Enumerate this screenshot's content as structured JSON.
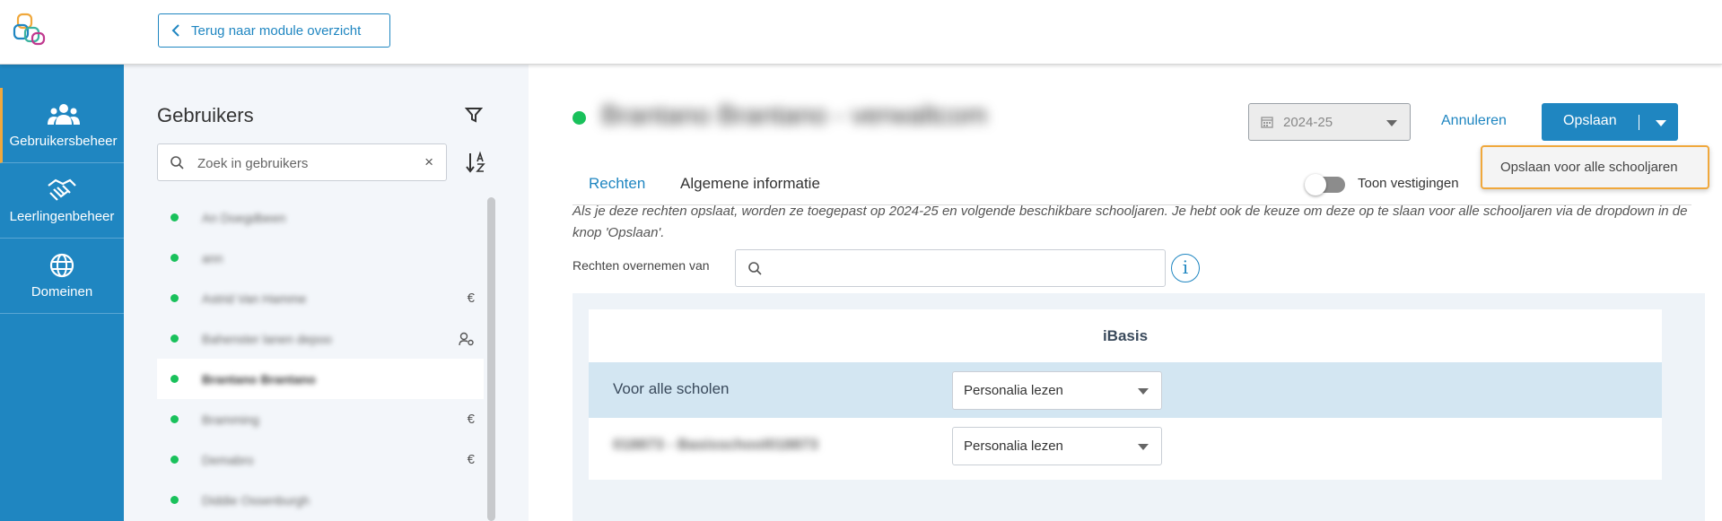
{
  "header": {
    "back_label": "Terug naar module overzicht"
  },
  "nav": {
    "items": [
      {
        "label": "Gebruikersbeheer",
        "icon": "users-icon",
        "active": true
      },
      {
        "label": "Leerlingenbeheer",
        "icon": "handshake-icon",
        "active": false
      },
      {
        "label": "Domeinen",
        "icon": "globe-icon",
        "active": false
      }
    ]
  },
  "users_panel": {
    "title": "Gebruikers",
    "search_placeholder": "Zoek in gebruikers",
    "clear_symbol": "×",
    "items": [
      {
        "name": "An Doegdbeen",
        "tag": ""
      },
      {
        "name": "ann",
        "tag": ""
      },
      {
        "name": "Astrid Van Hamme",
        "tag": "€"
      },
      {
        "name": "Bahenster lanen depoo",
        "tag": "user-cog"
      },
      {
        "name": "Brantano Brantano",
        "tag": "",
        "selected": true
      },
      {
        "name": "Bramming",
        "tag": "€"
      },
      {
        "name": "Demabro",
        "tag": "€"
      },
      {
        "name": "Diddie Ossenburgh",
        "tag": ""
      }
    ]
  },
  "main": {
    "title": "Brantano Brantano - verwaltcom",
    "year": "2024-25",
    "cancel_label": "Annuleren",
    "save_label": "Opslaan",
    "dropdown_option": "Opslaan voor alle schooljaren",
    "tabs": [
      "Rechten",
      "Algemene informatie"
    ],
    "toggle_label": "Toon vestigingen",
    "info_text": "Als je deze rechten opslaat, worden ze toegepast op 2024-25 en volgende beschikbare schooljaren. Je hebt ook de keuze om deze op te slaan voor alle schooljaren via de dropdown in de knop 'Opslaan'.",
    "copy_label": "Rechten overnemen van",
    "copy_placeholder": "",
    "info_symbol": "i",
    "table": {
      "header": "iBasis",
      "rows": [
        {
          "label": "Voor alle scholen",
          "value": "Personalia lezen"
        },
        {
          "label": "018873 - Basisschool018873",
          "value": "Personalia lezen"
        }
      ]
    }
  },
  "colors": {
    "brand": "#1f86c1",
    "status_green": "#19c15b",
    "highlight_orange": "#f0a83c"
  }
}
